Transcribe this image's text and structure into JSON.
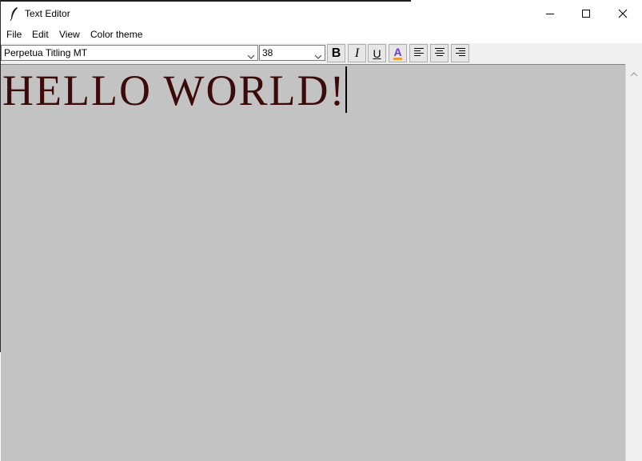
{
  "window": {
    "title": "Text Editor",
    "icons": {
      "app": "feather-pen-icon",
      "minimize": "minimize-icon",
      "maximize": "maximize-icon",
      "close": "close-icon"
    }
  },
  "menu": [
    "File",
    "Edit",
    "View",
    "Color theme"
  ],
  "toolbar": {
    "font_family": "Perpetua Titling MT",
    "font_size": "38",
    "bold_label": "B",
    "italic_label": "I",
    "underline_label": "U",
    "color_label": "A",
    "icons": {
      "align_left": "align-left-icon",
      "align_center": "align-center-icon",
      "align_right": "align-right-icon",
      "dropdown": "chevron-down-icon"
    },
    "colors": {
      "font_color_glyph": "#6a3fc8",
      "font_color_bar": "#e6a03a"
    }
  },
  "editor": {
    "content": "HELLO WORLD!",
    "text_color": "#3d0a0a",
    "background": "#c3c3c3"
  }
}
